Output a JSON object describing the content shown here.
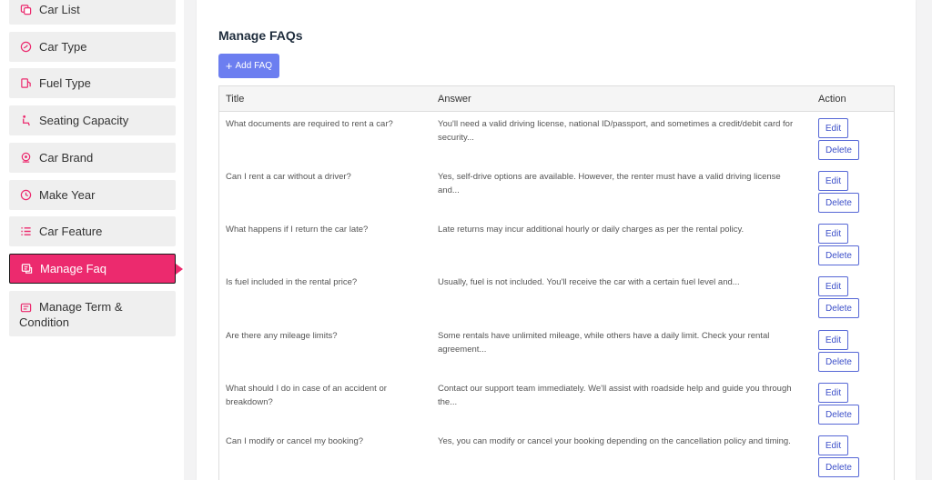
{
  "sidebar": {
    "items": [
      {
        "label": "Car List",
        "icon": "car-list-icon"
      },
      {
        "label": "Car Type",
        "icon": "gauge-icon"
      },
      {
        "label": "Fuel Type",
        "icon": "fuel-icon"
      },
      {
        "label": "Seating Capacity",
        "icon": "seat-icon"
      },
      {
        "label": "Car Brand",
        "icon": "brand-icon"
      },
      {
        "label": "Make Year",
        "icon": "clock-icon"
      },
      {
        "label": "Car Feature",
        "icon": "feature-list-icon"
      },
      {
        "label": "Manage Faq",
        "icon": "faq-icon",
        "active": true
      },
      {
        "label": "Manage Term & Condition",
        "icon": "terms-icon"
      }
    ]
  },
  "main": {
    "title": "Manage FAQs",
    "add_button": "Add FAQ",
    "columns": {
      "title": "Title",
      "answer": "Answer",
      "action": "Action"
    },
    "rows": [
      {
        "title": "What documents are required to rent a car?",
        "answer": "You'll need a valid driving license, national ID/passport, and sometimes a credit/debit card for security..."
      },
      {
        "title": "Can I rent a car without a driver?",
        "answer": "Yes, self-drive options are available. However, the renter must have a valid driving license and..."
      },
      {
        "title": "What happens if I return the car late?",
        "answer": "Late returns may incur additional hourly or daily charges as per the rental policy."
      },
      {
        "title": "Is fuel included in the rental price?",
        "answer": "Usually, fuel is not included. You'll receive the car with a certain fuel level and..."
      },
      {
        "title": "Are there any mileage limits?",
        "answer": "Some rentals have unlimited mileage, while others have a daily limit. Check your rental agreement..."
      },
      {
        "title": "What should I do in case of an accident or breakdown?",
        "answer": "Contact our support team immediately. We'll assist with roadside help and guide you through the..."
      },
      {
        "title": "Can I modify or cancel my booking?",
        "answer": "Yes, you can modify or cancel your booking depending on the cancellation policy and timing."
      }
    ],
    "edit_label": "Edit",
    "delete_label": "Delete"
  },
  "colors": {
    "accent": "#ec2a6e",
    "primary": "#6c7ef0",
    "button_outline": "#5667d6"
  }
}
